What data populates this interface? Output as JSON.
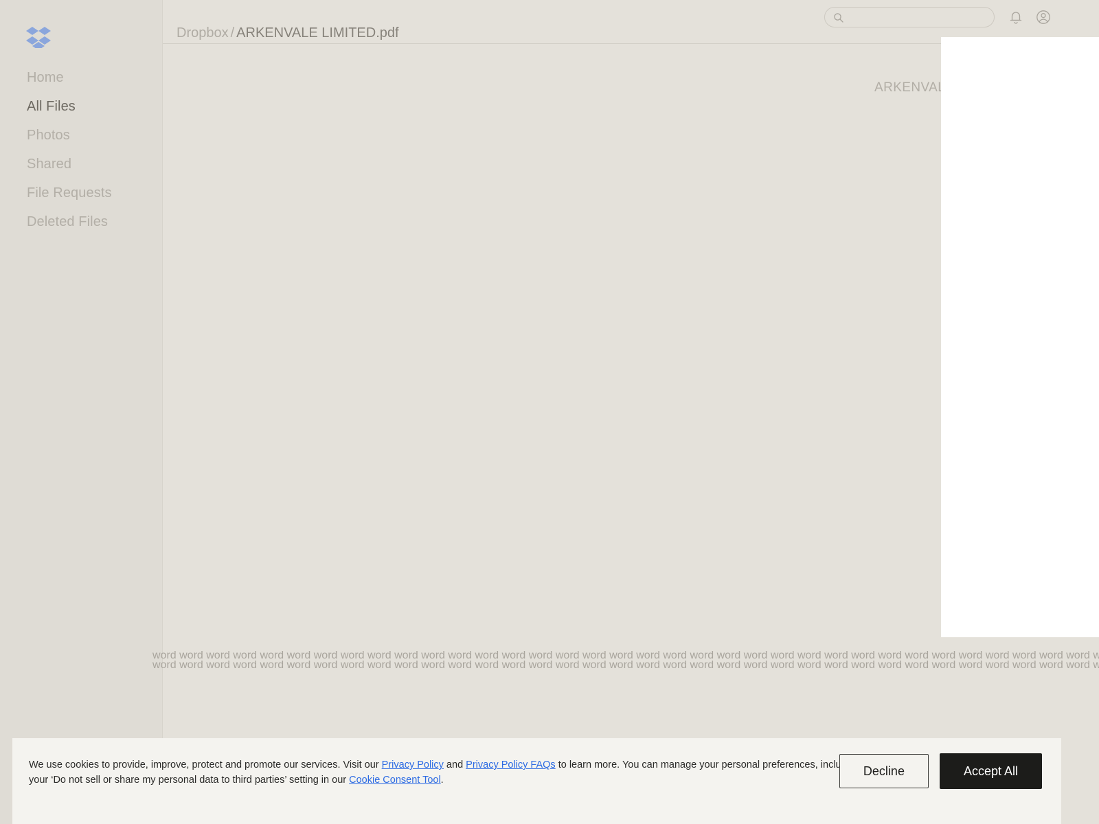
{
  "app": {
    "name": "Dropbox",
    "logo_color": "#8ba6dc",
    "background_color": "#e4e1da",
    "sidebar_color": "#dfdcd5"
  },
  "sidebar": {
    "logo_name": "dropbox-logo",
    "items": [
      {
        "label": "Home",
        "active": false
      },
      {
        "label": "All Files",
        "active": true
      },
      {
        "label": "Photos",
        "active": false
      },
      {
        "label": "Shared",
        "active": false
      },
      {
        "label": "File Requests",
        "active": false
      },
      {
        "label": "Deleted Files",
        "active": false
      }
    ]
  },
  "topbar": {
    "breadcrumb": {
      "root": "Dropbox",
      "separator": "/",
      "leaf": "ARKENVALE LIMITED.pdf"
    },
    "search": {
      "value": "",
      "placeholder": ""
    },
    "icons": [
      {
        "name": "notification-bell-icon"
      },
      {
        "name": "account-avatar-icon"
      }
    ]
  },
  "document": {
    "title": "ARKENVALE L",
    "body_line_1": "word word word word word word word word word word word word word word word word word word word word word word word word word word word word word word word word word word word word word word word word word word word",
    "body_line_2": "word word word word word word word word word word word word word word word word word word word word word word word word word word word word word word word word word word word word word word word word word word word"
  },
  "overlay": {
    "name": "blank-white-panel",
    "color": "#ffffff"
  },
  "cookie_banner": {
    "text_part_1": "We use cookies to provide, improve, protect and promote our services. Visit our ",
    "link_privacy_policy": "Privacy Policy",
    "text_part_2": " and ",
    "link_privacy_policy_faqs": "Privacy Policy FAQs",
    "text_part_3": " to learn more. You can manage your personal preferences, including your ‘Do not sell or share my personal data to third parties’ setting in our ",
    "link_cookie_consent_tool": "Cookie Consent Tool",
    "text_part_4": ".",
    "decline_label": "Decline",
    "accept_label": "Accept All",
    "background_color": "#f4f3ef",
    "link_color": "#2b6ae3",
    "accept_bg": "#1c1c1a"
  }
}
